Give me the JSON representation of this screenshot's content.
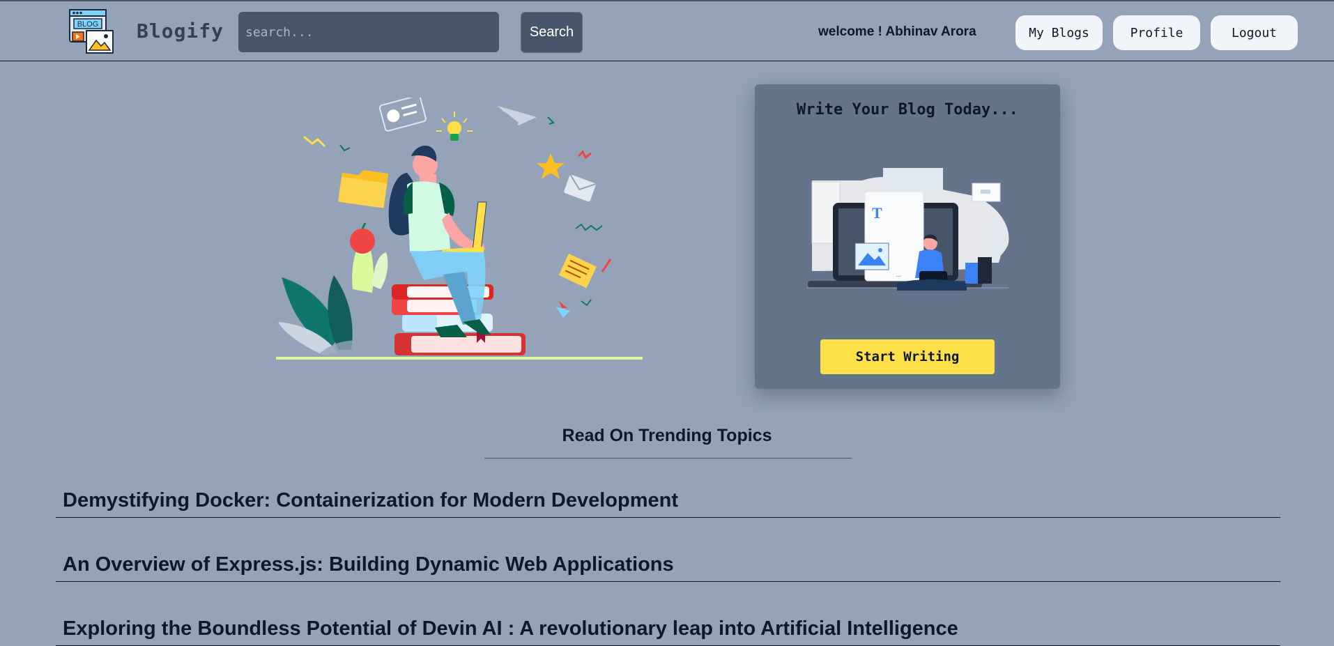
{
  "navbar": {
    "brand": "Blogify",
    "logo_text": "BLOG",
    "search_placeholder": "search...",
    "search_button": "Search",
    "welcome": "welcome ! Abhinav Arora",
    "my_blogs": "My Blogs",
    "profile": "Profile",
    "logout": "Logout"
  },
  "hero": {
    "card_title": "Write Your Blog Today...",
    "card_button": "Start Writing",
    "card_illustration_letter": "T"
  },
  "trending": {
    "title": "Read On Trending Topics",
    "posts": [
      {
        "title": "Demystifying Docker: Containerization for Modern Development"
      },
      {
        "title": "An Overview of Express.js: Building Dynamic Web Applications"
      },
      {
        "title": "Exploring the Boundless Potential of Devin AI : A revolutionary leap into Artificial Intelligence"
      }
    ]
  },
  "colors": {
    "background": "#94a3b8",
    "card": "#64748b",
    "input": "#475569",
    "accent_yellow": "#fde047",
    "text_dark": "#0f172a"
  }
}
